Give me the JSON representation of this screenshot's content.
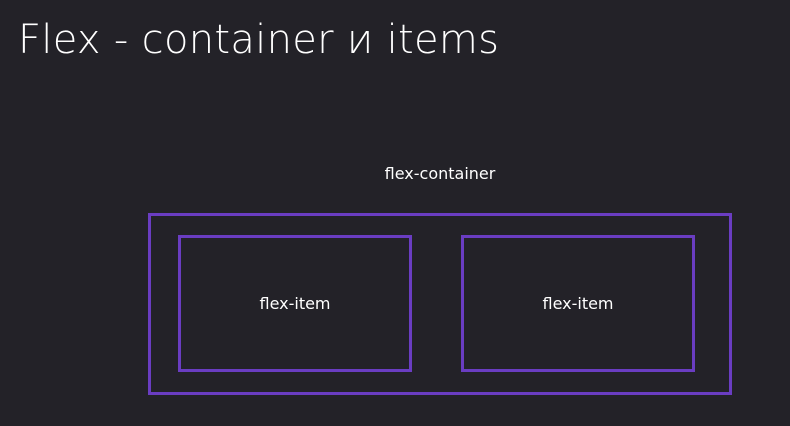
{
  "slide": {
    "title": "Flex - container и items"
  },
  "diagram": {
    "container_label": "flex-container",
    "items": [
      {
        "label": "flex-item"
      },
      {
        "label": "flex-item"
      }
    ],
    "colors": {
      "background": "#232228",
      "border": "#6a3dc2",
      "text": "#ffffff"
    }
  }
}
